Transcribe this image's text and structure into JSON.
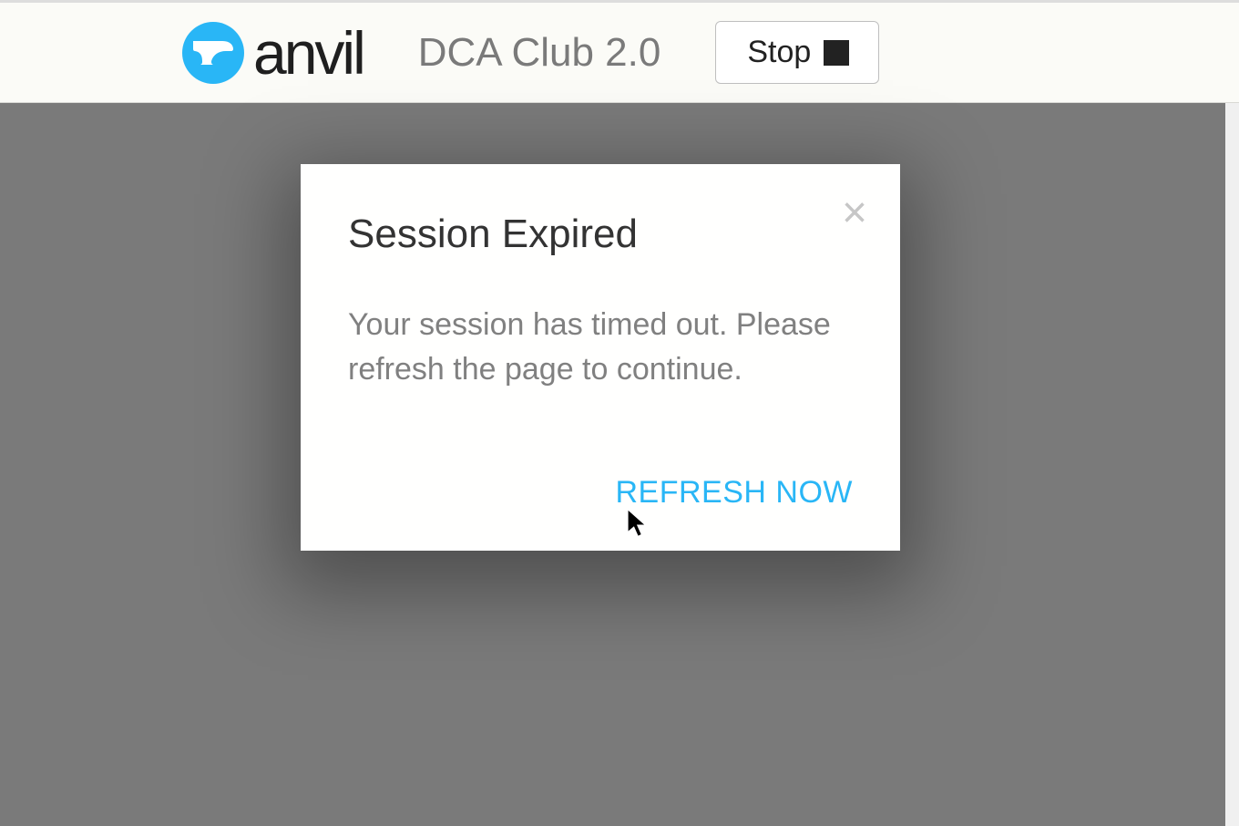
{
  "header": {
    "logo_text": "anvil",
    "app_title": "DCA Club 2.0",
    "stop_label": "Stop"
  },
  "modal": {
    "title": "Session Expired",
    "body": "Your session has timed out. Please refresh the page to continue.",
    "refresh_label": "REFRESH NOW"
  },
  "colors": {
    "accent": "#29b6f6",
    "overlay": "#7a7a7a",
    "modal_bg": "#fffffe"
  }
}
